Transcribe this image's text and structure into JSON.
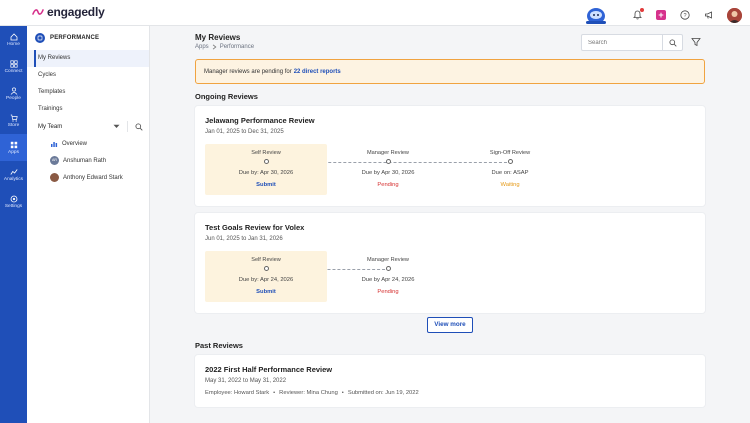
{
  "app": {
    "name": "engagedly"
  },
  "rail": [
    {
      "label": "Home",
      "icon": "home-icon"
    },
    {
      "label": "Connect",
      "icon": "connect-icon"
    },
    {
      "label": "People",
      "icon": "people-icon"
    },
    {
      "label": "Store",
      "icon": "store-icon"
    },
    {
      "label": "Apps",
      "icon": "apps-icon",
      "active": true
    },
    {
      "label": "Analytics",
      "icon": "analytics-icon"
    },
    {
      "label": "Settings",
      "icon": "settings-icon"
    }
  ],
  "sidebar": {
    "title": "PERFORMANCE",
    "items": [
      {
        "label": "My Reviews",
        "active": true
      },
      {
        "label": "Cycles"
      },
      {
        "label": "Templates"
      },
      {
        "label": "Trainings"
      }
    ],
    "my_team": "My Team",
    "team_items": [
      {
        "label": "Overview",
        "icon": "overview-chart-icon"
      },
      {
        "label": "Anshuman Rath",
        "initials": "AR"
      },
      {
        "label": "Anthony Edward Stark"
      }
    ]
  },
  "header": {
    "title": "My Reviews",
    "breadcrumb": [
      "Apps",
      "Performance"
    ],
    "search_placeholder": "Search"
  },
  "alert": {
    "text": "Manager reviews are pending for",
    "link": "22 direct reports"
  },
  "ongoing": {
    "title": "Ongoing Reviews",
    "reviews": [
      {
        "title": "Jelawang Performance Review",
        "dates": "Jan 01, 2025 to Dec 31, 2025",
        "stages": [
          {
            "name": "Self Review",
            "due": "Due by: Apr 30, 2026",
            "status": "Submit"
          },
          {
            "name": "Manager Review",
            "due": "Due by Apr 30, 2026",
            "status": "Pending"
          },
          {
            "name": "Sign-Off Review",
            "due": "Due on: ASAP",
            "status": "Waiting"
          }
        ]
      },
      {
        "title": "Test Goals Review for Volex",
        "dates": "Jun 01, 2025 to Jan 31, 2026",
        "stages": [
          {
            "name": "Self Review",
            "due": "Due by: Apr 24, 2026",
            "status": "Submit"
          },
          {
            "name": "Manager Review",
            "due": "Due by Apr 24, 2026",
            "status": "Pending"
          }
        ]
      }
    ],
    "view_more": "View more"
  },
  "past": {
    "title": "Past Reviews",
    "reviews": [
      {
        "title": "2022 First Half Performance Review",
        "dates": "May 31, 2022 to May 31, 2022",
        "employee": "Employee: Howard Stark",
        "reviewer": "Reviewer: Mina Chung",
        "submitted": "Submitted on: Jun 19, 2022"
      }
    ]
  },
  "colors": {
    "brand": "#1f4fb8",
    "pending": "#d63333",
    "waiting": "#e59a17",
    "alert_border": "#f0a340",
    "highlight_stage": "#fdf3de"
  }
}
